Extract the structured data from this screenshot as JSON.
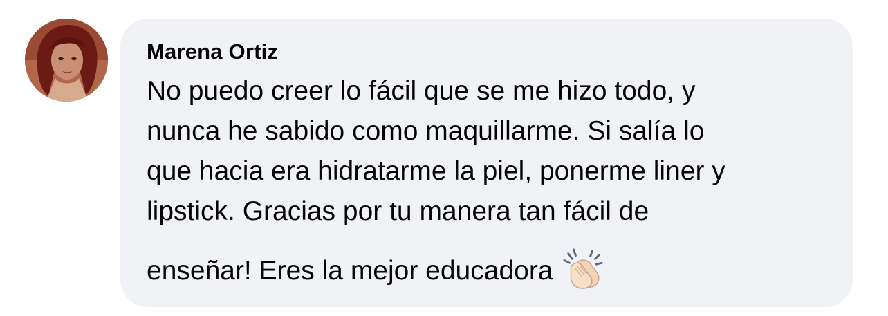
{
  "comment": {
    "author": "Marena Ortiz",
    "lines": [
      "No puedo creer lo fácil que se me hizo todo, y",
      "nunca he sabido como maquillarme. Si salía lo",
      "que hacia era hidratarme la piel, ponerme liner y",
      "lipstick. Gracias por tu manera tan fácil de",
      "enseñar! Eres la mejor educadora"
    ],
    "emoji": "clapping-hands-icon"
  },
  "colors": {
    "bubble": "#f0f2f5",
    "text": "#050505"
  }
}
